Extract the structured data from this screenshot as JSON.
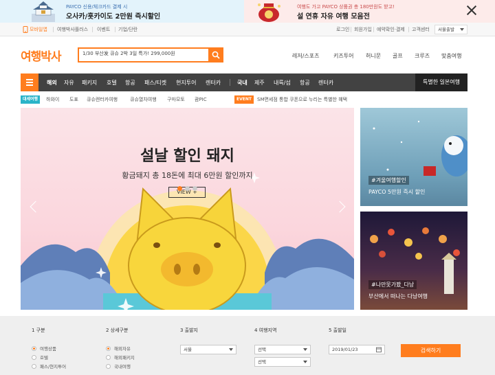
{
  "promo": {
    "left_small": "PAYCO 신용/체크카드 결제 시",
    "left_big": "오사카/홋카이도 2만원 즉시할인",
    "right_small": "여행도 가고 PAYCO 상품권 총 180만원도 받고!",
    "right_big": "설 연휴 자유 여행 모음전"
  },
  "util": {
    "mobile_app": "모바일앱",
    "links_left": [
      "여행박사플러스",
      "이벤트",
      "기업/단란"
    ],
    "links_right": [
      "로그인",
      "회원가입",
      "예약확인·결제",
      "고객센터"
    ],
    "departure": "서울출발"
  },
  "header": {
    "logo": "여행박사",
    "search_value": "1/30 부산发 큐슈 2박 3일 특가! 299,000원",
    "links": [
      "레저/스포츠",
      "키즈투어",
      "허니문",
      "골프",
      "크루즈",
      "맞춤여행"
    ]
  },
  "gnb": {
    "overseas": [
      "해외",
      "자유",
      "패키지",
      "호텔",
      "항공",
      "패스/티켓",
      "현지투어",
      "렌터카"
    ],
    "domestic": [
      "국내",
      "제주",
      "내륙/섬",
      "항공",
      "렌터카"
    ],
    "special": "특별한 일본여행"
  },
  "subnav": {
    "badge": "대세여행",
    "items": [
      "하와이",
      "도표",
      "큐슈렌터카여행",
      "큐슈열차여행",
      "구마모토",
      "괌PIC"
    ],
    "event_badge": "EVENT",
    "event_text": "SM면세점 통합 쿠폰으로 누리는 특별한 혜택"
  },
  "banner": {
    "title": "설날 할인 돼지",
    "subtitle": "황금돼지 총 18돈에 최대 6만원 할인까지",
    "cta": "VIEW +"
  },
  "side_cards": [
    {
      "tag": "#겨울여행할인",
      "text": "PAYCO 5만원 즉시 할인"
    },
    {
      "tag": "#나만못가봤_다낭",
      "text": "부산에서 떠나는 다낭여행"
    }
  ],
  "form": {
    "steps": [
      "1  구분",
      "2  상세구분",
      "3  출발지",
      "4  여행지역",
      "5  출발일"
    ],
    "step1_options": [
      "여행상품",
      "호텔",
      "패스/현지투어"
    ],
    "step2_options": [
      "해외자유",
      "해외패키지",
      "국내여행"
    ],
    "departure": "서울",
    "region1": "선택",
    "region2": "선택",
    "date": "2019/01/23",
    "submit": "검색하기"
  },
  "colors": {
    "accent": "#ff7d1e",
    "gnb": "#424242"
  }
}
